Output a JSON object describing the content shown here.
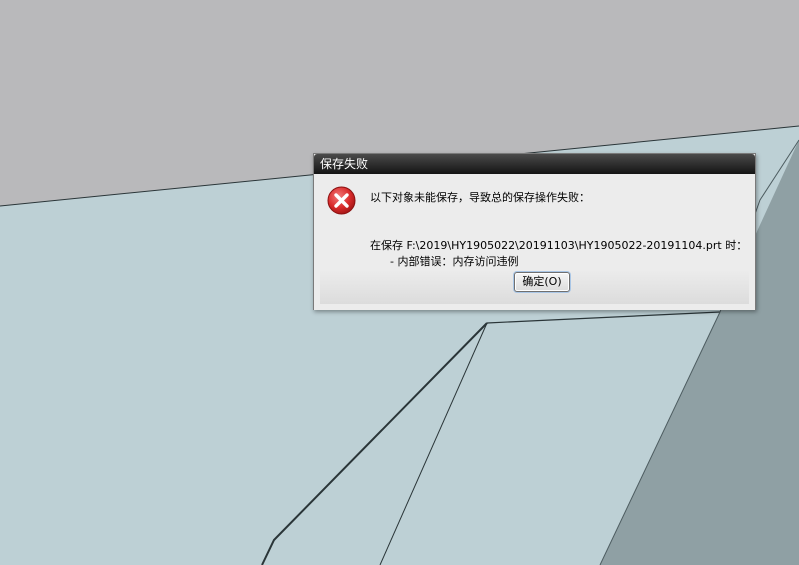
{
  "dialog": {
    "title": "保存失败",
    "icon": "error-icon",
    "message": "以下对象未能保存，导致总的保存操作失败：",
    "detail_path": "在保存 F:\\2019\\HY1905022\\20191103\\HY1905022-20191104.prt 时：",
    "detail_error": "-   内部错误：内存访问违例",
    "ok_label": "确定(O)"
  },
  "colors": {
    "background_top": "#b9b9bb",
    "model_face_light": "#bdd0d5",
    "model_face_dark": "#8fa0a4",
    "error_red": "#d92b2b"
  }
}
